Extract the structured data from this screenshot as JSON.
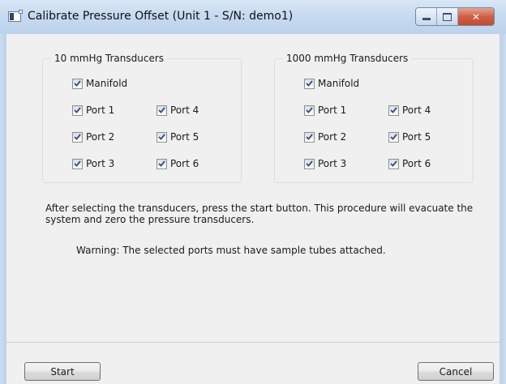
{
  "window": {
    "title": "Calibrate Pressure Offset (Unit 1 - S/N: demo1)",
    "close_glyph": "✕"
  },
  "groups": [
    {
      "label": "10 mmHg Transducers",
      "manifold": {
        "label": "Manifold",
        "checked": true
      },
      "ports": [
        {
          "label": "Port 1",
          "checked": true
        },
        {
          "label": "Port 2",
          "checked": true
        },
        {
          "label": "Port 3",
          "checked": true
        },
        {
          "label": "Port 4",
          "checked": true
        },
        {
          "label": "Port 5",
          "checked": true
        },
        {
          "label": "Port 6",
          "checked": true
        }
      ]
    },
    {
      "label": "1000 mmHg Transducers",
      "manifold": {
        "label": "Manifold",
        "checked": true
      },
      "ports": [
        {
          "label": "Port 1",
          "checked": true
        },
        {
          "label": "Port 2",
          "checked": true
        },
        {
          "label": "Port 3",
          "checked": true
        },
        {
          "label": "Port 4",
          "checked": true
        },
        {
          "label": "Port 5",
          "checked": true
        },
        {
          "label": "Port 6",
          "checked": true
        }
      ]
    }
  ],
  "instructions": "After selecting the transducers, press the start button. This procedure will evacuate the system and zero the pressure transducers.",
  "warning": "Warning: The selected ports must have sample tubes attached.",
  "buttons": {
    "start": "Start",
    "cancel": "Cancel"
  },
  "colors": {
    "check_mark": "#2c4c8c",
    "close_button": "#c44a30"
  }
}
